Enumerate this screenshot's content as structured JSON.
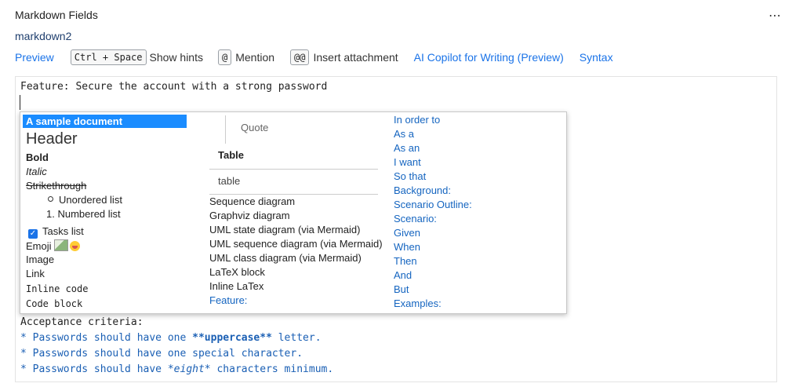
{
  "header": {
    "title": "Markdown Fields",
    "more_icon": "⋯",
    "field_name": "markdown2"
  },
  "toolbar": {
    "preview": "Preview",
    "hints_key": "Ctrl + Space",
    "hints_label": "Show hints",
    "mention_key": "@",
    "mention_label": "Mention",
    "attach_key": "@@",
    "attach_label": "Insert attachment",
    "copilot": "AI Copilot for Writing (Preview)",
    "syntax": "Syntax"
  },
  "editor": {
    "line1": "Feature: Secure the account with a strong password",
    "line_ac": "Acceptance criteria:",
    "bullet1_pre": "* Passwords should have one ",
    "bullet1_bold": "**uppercase**",
    "bullet1_post": " letter.",
    "bullet2": "* Passwords should have one special character.",
    "bullet3_pre": "* Passwords should have ",
    "bullet3_em": "*eight*",
    "bullet3_post": " characters minimum."
  },
  "hints": {
    "col1": {
      "sample": "A sample document",
      "header": "Header",
      "bold": "Bold",
      "italic": "Italic",
      "strike": "Strikethrough",
      "unordered": "Unordered list",
      "numbered": "1. Numbered list",
      "tasks": "Tasks list",
      "emoji": "Emoji",
      "image": "Image",
      "link": "Link",
      "inline_code": "Inline code",
      "code_block": "Code block"
    },
    "col2": {
      "quote": "Quote",
      "table_header": "Table",
      "table_cell": "table",
      "sequence": "Sequence diagram",
      "graphviz": "Graphviz diagram",
      "uml_state": "UML state diagram (via Mermaid)",
      "uml_sequence": "UML sequence diagram (via Mermaid)",
      "uml_class": "UML class diagram (via Mermaid)",
      "latex_block": "LaTeX block",
      "latex_inline": "Inline LaTex",
      "feature": "Feature:"
    },
    "col3": [
      "In order to",
      "As a",
      "As an",
      "I want",
      "So that",
      "Background:",
      "Scenario Outline:",
      "Scenario:",
      "Given",
      "When",
      "Then",
      "And",
      "But",
      "Examples:"
    ]
  }
}
